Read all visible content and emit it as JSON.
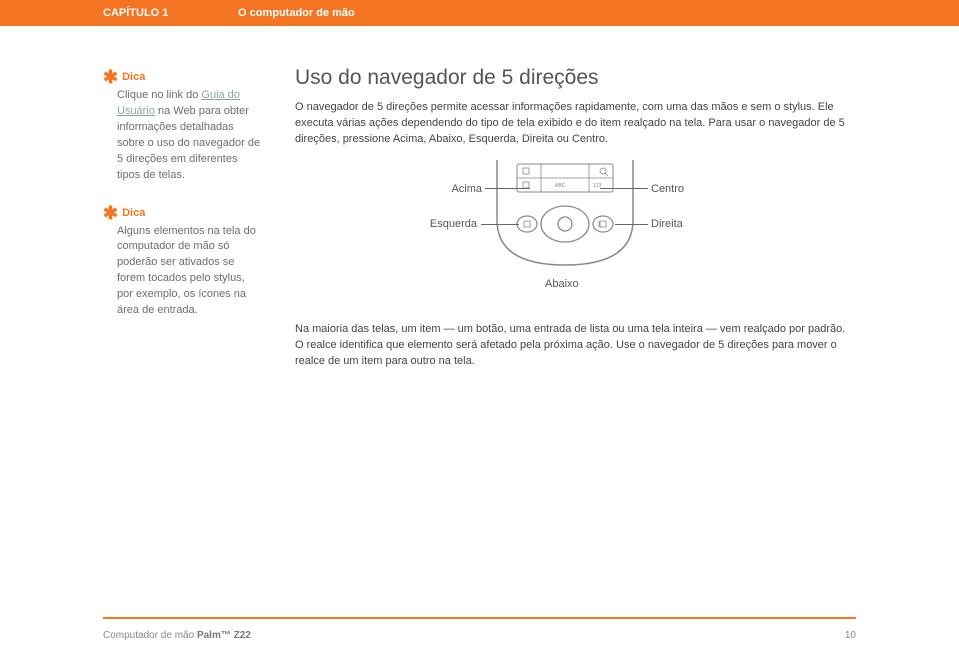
{
  "header": {
    "chapter": "CAPÍTULO 1",
    "topic": "O computador de mão"
  },
  "sidebar": {
    "tips": [
      {
        "label": "Dica",
        "segments": {
          "pre": "Clique no link do ",
          "link": "Guia do Usuário",
          "post": " na Web para obter informações detalhadas sobre o uso do navegador de 5 direções em diferentes tipos de telas."
        }
      },
      {
        "label": "Dica",
        "body": "Alguns elementos na tela do computador de mão só poderão ser ativados se forem tocados pelo stylus, por exemplo, os ícones na área de entrada."
      }
    ]
  },
  "main": {
    "heading": "Uso do navegador de 5 direções",
    "p1": "O navegador de 5 direções permite acessar informações rapidamente, com uma das mãos e sem o stylus. Ele executa várias ações dependendo do tipo de tela exibido e do item realçado na tela. Para usar o navegador de 5 direções, pressione Acima, Abaixo, Esquerda, Direita ou Centro.",
    "diagram": {
      "acima": "Acima",
      "abaixo": "Abaixo",
      "esquerda": "Esquerda",
      "direita": "Direita",
      "centro": "Centro"
    },
    "p2": "Na maioria das telas, um item — um botão, uma entrada de lista ou uma tela inteira — vem realçado por padrão. O realce identifica que elemento será afetado pela próxima ação. Use o navegador de 5 direções para mover o realce de um item para outro na tela."
  },
  "footer": {
    "product_pre": "Computador de mão ",
    "product_bold": "Palm™ Z22",
    "page_number": "10"
  }
}
